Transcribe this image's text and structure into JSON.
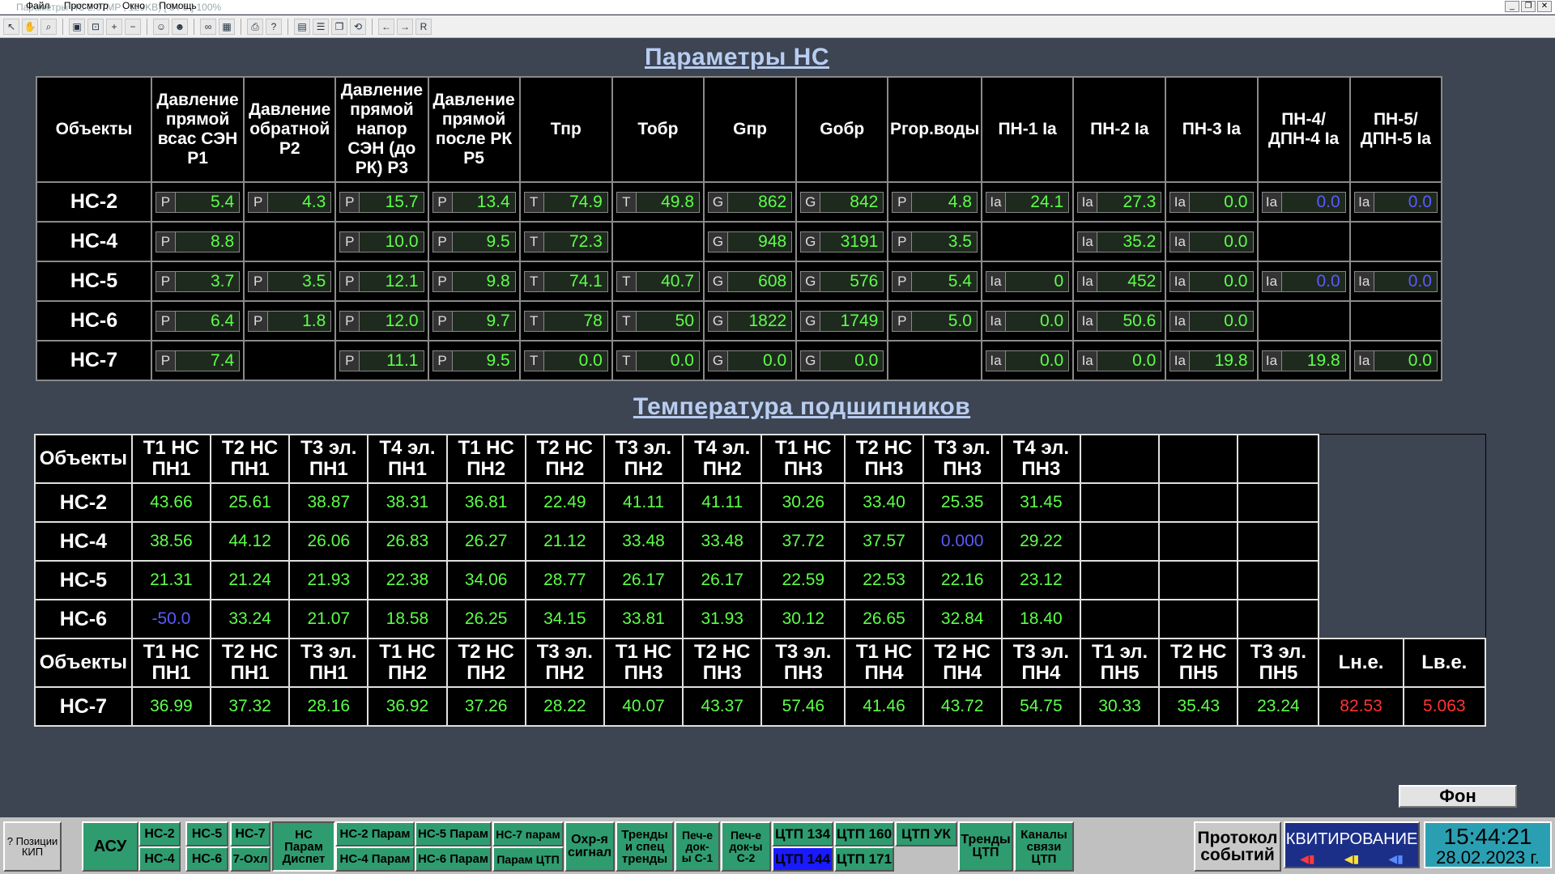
{
  "window": {
    "title": "Параметры НС 2.07MP , 129KB) [ 5 / 5 ] 100%",
    "menu": [
      "Файл",
      "Просмотр",
      "Окно",
      "Помощь"
    ],
    "zoom": "100%"
  },
  "toolbar": {
    "icons": [
      "cursor-icon",
      "hand-icon",
      "zoom-icon",
      "fit-icon",
      "zoom-fit-icon",
      "zoom-in-icon",
      "zoom-out-icon",
      "people-icon",
      "people2-icon",
      "binoculars-icon",
      "calendar-icon",
      "print-icon",
      "help-icon",
      "layout1-icon",
      "layout2-icon",
      "window-icon",
      "refresh-icon",
      "back-icon",
      "forward-icon",
      "r-icon"
    ],
    "r_label": "R"
  },
  "params": {
    "title": "Параметры НС",
    "headers": [
      "Объекты",
      "Давление прямой всас СЭН Р1",
      "Давление обратной Р2",
      "Давление прямой напор СЭН (до РК) Р3",
      "Давление прямой после РК Р5",
      "Тпр",
      "Тобр",
      "Gпр",
      "Gобр",
      "Pгор.воды",
      "ПН-1 Ia",
      "ПН-2 Ia",
      "ПН-3 Ia",
      "ПН-4/ ДПН-4 Ia",
      "ПН-5/ ДПН-5 Ia"
    ],
    "rows": [
      {
        "name": "НС-2",
        "cells": [
          [
            "P",
            "5.4"
          ],
          [
            "P",
            "4.3"
          ],
          [
            "P",
            "15.7"
          ],
          [
            "P",
            "13.4"
          ],
          [
            "T",
            "74.9"
          ],
          [
            "T",
            "49.8"
          ],
          [
            "G",
            "862"
          ],
          [
            "G",
            "842"
          ],
          [
            "P",
            "4.8"
          ],
          [
            "Ia",
            "24.1"
          ],
          [
            "Ia",
            "27.3"
          ],
          [
            "Ia",
            "0.0"
          ],
          [
            "Ia",
            "0.0",
            "b"
          ],
          [
            "Ia",
            "0.0",
            "b"
          ]
        ]
      },
      {
        "name": "НС-4",
        "cells": [
          [
            "P",
            "8.8"
          ],
          null,
          [
            "P",
            "10.0"
          ],
          [
            "P",
            "9.5"
          ],
          [
            "T",
            "72.3"
          ],
          null,
          [
            "G",
            "948"
          ],
          [
            "G",
            "3191"
          ],
          [
            "P",
            "3.5"
          ],
          null,
          [
            "Ia",
            "35.2"
          ],
          [
            "Ia",
            "0.0"
          ],
          null,
          null
        ]
      },
      {
        "name": "НС-5",
        "cells": [
          [
            "P",
            "3.7"
          ],
          [
            "P",
            "3.5"
          ],
          [
            "P",
            "12.1"
          ],
          [
            "P",
            "9.8"
          ],
          [
            "T",
            "74.1"
          ],
          [
            "T",
            "40.7"
          ],
          [
            "G",
            "608"
          ],
          [
            "G",
            "576"
          ],
          [
            "P",
            "5.4"
          ],
          [
            "Ia",
            "0"
          ],
          [
            "Ia",
            "452"
          ],
          [
            "Ia",
            "0.0"
          ],
          [
            "Ia",
            "0.0",
            "b"
          ],
          [
            "Ia",
            "0.0",
            "b"
          ]
        ]
      },
      {
        "name": "НС-6",
        "cells": [
          [
            "P",
            "6.4"
          ],
          [
            "P",
            "1.8"
          ],
          [
            "P",
            "12.0"
          ],
          [
            "P",
            "9.7"
          ],
          [
            "T",
            "78"
          ],
          [
            "T",
            "50"
          ],
          [
            "G",
            "1822"
          ],
          [
            "G",
            "1749"
          ],
          [
            "P",
            "5.0"
          ],
          [
            "Ia",
            "0.0"
          ],
          [
            "Ia",
            "50.6"
          ],
          [
            "Ia",
            "0.0"
          ],
          null,
          null
        ]
      },
      {
        "name": "НС-7",
        "cells": [
          [
            "P",
            "7.4"
          ],
          null,
          [
            "P",
            "11.1"
          ],
          [
            "P",
            "9.5"
          ],
          [
            "T",
            "0.0"
          ],
          [
            "T",
            "0.0"
          ],
          [
            "G",
            "0.0"
          ],
          [
            "G",
            "0.0"
          ],
          null,
          [
            "Ia",
            "0.0"
          ],
          [
            "Ia",
            "0.0"
          ],
          [
            "Ia",
            "19.8"
          ],
          [
            "Ia",
            "19.8"
          ],
          [
            "Ia",
            "0.0"
          ]
        ]
      }
    ]
  },
  "bearings": {
    "title": "Температура подшипников",
    "headers": [
      "Объекты",
      "Т1 НС ПН1",
      "Т2 НС ПН1",
      "Т3 эл. ПН1",
      "Т4 эл. ПН1",
      "Т1 НС ПН2",
      "Т2 НС ПН2",
      "Т3 эл. ПН2",
      "Т4 эл. ПН2",
      "Т1 НС ПН3",
      "Т2 НС ПН3",
      "Т3 эл. ПН3",
      "Т4 эл. ПН3",
      "",
      "",
      ""
    ],
    "rows": [
      {
        "name": "НС-2",
        "values": [
          "43.66",
          "25.61",
          "38.87",
          "38.31",
          "36.81",
          "22.49",
          "41.11",
          "41.11",
          "30.26",
          "33.40",
          "25.35",
          "31.45"
        ]
      },
      {
        "name": "НС-4",
        "values": [
          "38.56",
          "44.12",
          "26.06",
          "26.83",
          "26.27",
          "21.12",
          "33.48",
          "33.48",
          "37.72",
          "37.57",
          "0.000",
          "29.22"
        ],
        "blue": [
          10
        ]
      },
      {
        "name": "НС-5",
        "values": [
          "21.31",
          "21.24",
          "21.93",
          "22.38",
          "34.06",
          "28.77",
          "26.17",
          "26.17",
          "22.59",
          "22.53",
          "22.16",
          "23.12"
        ]
      },
      {
        "name": "НС-6",
        "values": [
          "-50.0",
          "33.24",
          "21.07",
          "18.58",
          "26.25",
          "34.15",
          "33.81",
          "31.93",
          "30.12",
          "26.65",
          "32.84",
          "18.40"
        ],
        "blue": [
          0
        ]
      }
    ],
    "headers2": [
      "Объекты",
      "Т1 НС ПН1",
      "Т2 НС ПН1",
      "Т3 эл. ПН1",
      "Т1 НС ПН2",
      "Т2 НС ПН2",
      "Т3 эл. ПН2",
      "Т1 НС ПН3",
      "Т2 НС ПН3",
      "Т3 эл. ПН3",
      "Т1 НС ПН4",
      "Т2 НС ПН4",
      "Т3 эл. ПН4",
      "Т1 эл. ПН5",
      "Т2 НС ПН5",
      "Т3 эл. ПН5",
      "Lн.е.",
      "Lв.е."
    ],
    "row7": {
      "name": "НС-7",
      "values": [
        "36.99",
        "37.32",
        "28.16",
        "36.92",
        "37.26",
        "28.22",
        "40.07",
        "43.37",
        "57.46",
        "41.46",
        "43.72",
        "54.75",
        "30.33",
        "35.43",
        "23.24",
        "82.53",
        "5.063"
      ],
      "red": [
        15,
        16
      ]
    }
  },
  "fon_button": "Фон",
  "navbar": {
    "help": "? Позиции КИП",
    "asu": "АСУ",
    "ns2": "НС-2",
    "ns5": "НС-5",
    "ns7": "НС-7",
    "ns4": "НС-4",
    "ns6": "НС-6",
    "ohl7": "7-Охл",
    "ns_param": "НС Парам Диспет",
    "ns2_param": "НС-2 Парам",
    "ns5_param": "НС-5 Парам",
    "ns7_param": "НС-7 парам",
    "ns4_param": "НС-4 Парам",
    "ns6_param": "НС-6 Парам",
    "ctp_param": "Парам ЦТП",
    "ohr": "Охр-я сигнал",
    "trends": "Тренды и спец тренды",
    "pech1": "Печ-е док-ы С-1",
    "pech2": "Печ-е док-ы С-2",
    "ctp134": "ЦТП 134",
    "ctp160": "ЦТП 160",
    "ctp_uk": "ЦТП УК",
    "ctp144": "ЦТП 144",
    "ctp171": "ЦТП 171",
    "trends_ctp": "Тренды ЦТП",
    "channels": "Каналы связи ЦТП",
    "protocol": "Протокол событий",
    "kvit": "КВИТИРОВАНИЕ",
    "time": "15:44:21",
    "date": "28.02.2023 г."
  },
  "colors": {
    "background": "#3d4452",
    "value_green": "#5dff49",
    "value_blue": "#5a5aff",
    "value_red": "#ff3333",
    "nav_green": "#2f9c6f"
  }
}
